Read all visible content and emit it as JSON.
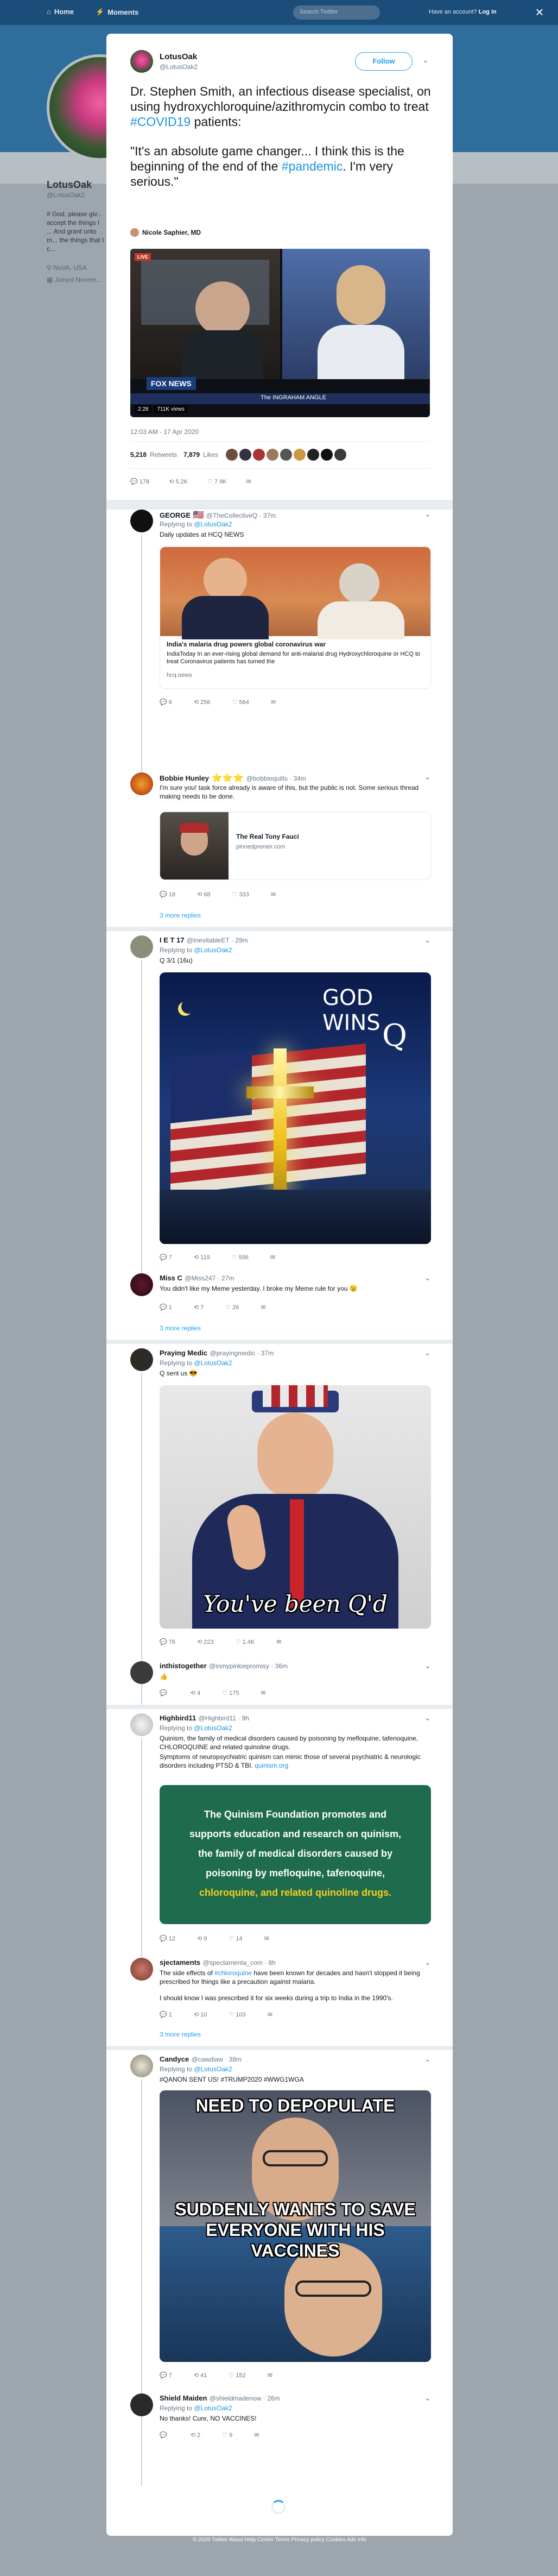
{
  "nav": {
    "home": "Home",
    "moments": "Moments",
    "search_placeholder": "Search Twitter",
    "account": "Have an account?",
    "login": "Log in",
    "close": "×"
  },
  "background_profile": {
    "name": "LotusOak",
    "handle": "@LotusOak2",
    "bio": "# God, please giv... accept the things I ... And grant unto m... the things that I c...",
    "location": "NoVA, USA",
    "joined": "Joined Novem..."
  },
  "main_tweet": {
    "name": "LotusOak",
    "handle": "@LotusOak2",
    "follow_label": "Follow",
    "text_part1_a": "Dr. Stephen Smith, an infectious disease specialist, on using hydroxychloroquine/azithromycin combo to treat ",
    "text_part1_tag": "#COVID19",
    "text_part1_b": " patients:",
    "text_part2_a": "\"It's an absolute game changer... I think this is the beginning of the end of the ",
    "text_part2_tag": "#pandemic",
    "text_part2_b": ". I'm very serious.\"",
    "author_credit": "Nicole Saphier, MD",
    "video_time": "2:28",
    "video_views": "711K views",
    "video_live": "LIVE",
    "video_network": "FOX NEWS",
    "video_chyron": "The INGRAHAM ANGLE",
    "timestamp": "12:03 AM - 17 Apr 2020",
    "retweets_count": "5,218",
    "retweets_label": "Retweets",
    "likes_count": "7,879",
    "likes_label": "Likes",
    "action_replies": "178",
    "action_retweets": "5.2K",
    "action_likes": "7.9K"
  },
  "replies": [
    {
      "name": "GEORGE",
      "flag": "🇺🇸",
      "handle": "@TheCollectiveQ · 37m",
      "replying": "Replying to ",
      "replying_to": "@LotusOak2",
      "text": "Daily updates at HCQ NEWS",
      "card_title": "India's malaria drug powers global coronavirus war",
      "card_desc": "IndiaToday In an ever-rising global demand for anti-malarial drug Hydroxychloroquine or HCQ to treat Coronavirus patients has turned the",
      "card_domain": "hcq.news",
      "replies": "6",
      "retweets": "256",
      "likes": "564"
    },
    {
      "name": "Bobbie Hunley",
      "stars": "⭐⭐⭐",
      "handle": "@bobbiequilts · 34m",
      "text": "I'm sure you! task force already is aware of this, but the public is not.  Some serious thread making needs to be done.",
      "card_title": "The Real Tony Fauci",
      "card_domain": "pinnedpreneir.com",
      "replies": "18",
      "retweets": "68",
      "likes": "333",
      "more": "3 more replies"
    },
    {
      "name": "I E T 17",
      "handle": "@InevitableET · 29m",
      "replying": "Replying to ",
      "replying_to": "@LotusOak2",
      "text": "Q 3/1 (16u)",
      "image_text_top": "GOD WINS",
      "image_text_q": "Q",
      "replies": "7",
      "retweets": "119",
      "likes": "596"
    },
    {
      "name": "Miss C",
      "handle": "@Miss247 · 27m",
      "text": "You didn't like my Meme yesterday. I broke my Meme rule for you 😉",
      "replies": "1",
      "retweets": "7",
      "likes": "26",
      "more": "3 more replies"
    },
    {
      "name": "Praying Medic",
      "handle": "@prayingmedic · 37m",
      "replying": "Replying to ",
      "replying_to": "@LotusOak2",
      "text": "Q sent us 😎",
      "image_caption": "You've been Q'd",
      "replies": "76",
      "retweets": "223",
      "likes": "1.4K"
    },
    {
      "name": "inthistogether",
      "handle": "@inmypinkiepromisy · 36m",
      "text": "👍",
      "replies": "",
      "retweets": "4",
      "likes": "175"
    },
    {
      "name": "Highbird11",
      "handle": "@Highbird11 · 9h",
      "replying": "Replying to ",
      "replying_to": "@LotusOak2",
      "text1": "Quinism, the  family of medical disorders caused by poisoning by mefloquine, tafenoquine, CHLOROQUINE and related quinoline drugs.",
      "text2": "Symptoms  of neuropsychiatric quinism  can mimic those of several psychiatric & neurologic  disorders including PTSD & TBI. ",
      "text2_link": "quinism.org",
      "green_a": "The Quinism Foundation promotes and supports education and research on quinism, the family of medical disorders caused by poisoning by mefloquine, tafenoquine, ",
      "green_b": "chloroquine, and related quinoline drugs.",
      "replies": "12",
      "retweets": "9",
      "likes": "14"
    },
    {
      "name": "sjectaments",
      "handle": "@spectamenta_com · 8h",
      "text1a": "The side effects of ",
      "text1_tag": "#chloroquine",
      "text1b": " have been known for decades and hasn't stopped it being prescribed for things like a precaution against malaria.",
      "text2": "I should know I was prescribed it for six weeks during a trip to India in the 1990's.",
      "replies": "1",
      "retweets": "10",
      "likes": "103",
      "more": "3 more replies"
    },
    {
      "name": "Candyce",
      "handle": "@cawdiaw · 38m",
      "replying": "Replying to ",
      "replying_to": "@LotusOak2",
      "text_tags": "#QANON SENT US! #TRUMP2020 #WWG1WGA",
      "meme_top": "NEED TO DEPOPULATE",
      "meme_mid": "SUDDENLY WANTS TO SAVE EVERYONE WITH HIS VACCINES",
      "replies": "7",
      "retweets": "41",
      "likes": "152"
    },
    {
      "name": "Shield Maiden",
      "handle": "@shieldmadenow · 26m",
      "replying": "Replying to ",
      "replying_to": "@LotusOak2",
      "text": "No thanks! Cure, NO VACCINES!",
      "replies": "",
      "retweets": "2",
      "likes": "9"
    }
  ],
  "footer": {
    "links": "© 2020 Twitter   About   Help Center   Terms   Privacy policy   Cookies   Ads info"
  }
}
